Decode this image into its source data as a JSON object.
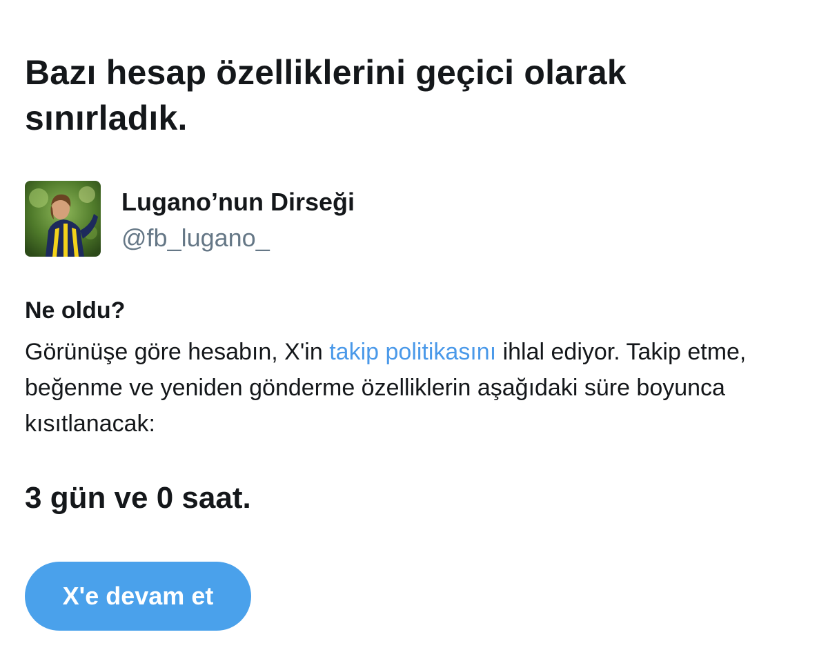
{
  "header": {
    "title": "Bazı hesap özelliklerini geçici olarak sınırladık."
  },
  "profile": {
    "display_name": "Lugano’nun Dirseği",
    "handle": "@fb_lugano_",
    "avatar_icon": "user-photo"
  },
  "info": {
    "heading": "Ne oldu?",
    "text_before_link": "Görünüşe göre hesabın, X'in ",
    "link_text": "takip politikasını",
    "text_after_link": " ihlal ediyor. Takip etme, beğenme ve yeniden gönderme özelliklerin aşağıdaki süre boyunca kısıtlanacak:"
  },
  "restriction": {
    "duration": "3 gün ve 0 saat."
  },
  "actions": {
    "continue_label": "X'e devam et"
  },
  "colors": {
    "text_primary": "#14171a",
    "text_secondary": "#657786",
    "link": "#4a99e9",
    "button_bg": "#4aa1eb",
    "button_text": "#ffffff"
  }
}
